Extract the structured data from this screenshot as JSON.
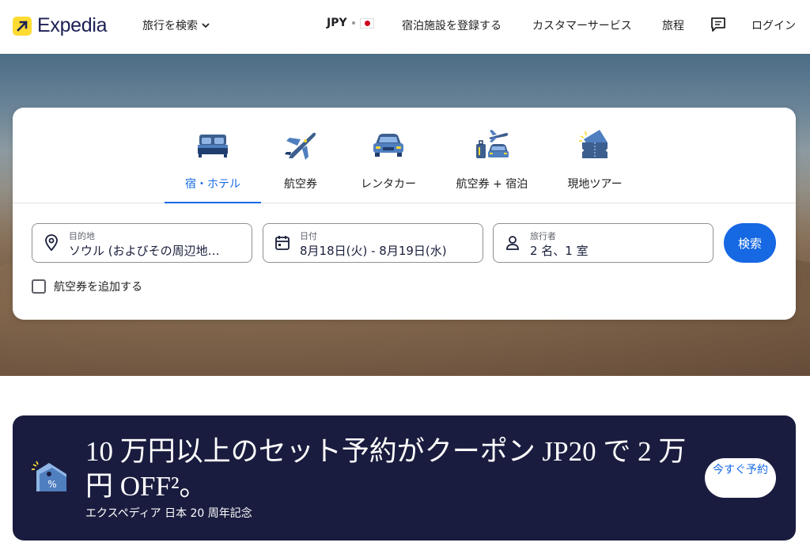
{
  "header": {
    "logo_text": "Expedia",
    "search_menu": "旅行を検索",
    "currency": "JPY",
    "list_property": "宿泊施設を登録する",
    "customer_service": "カスタマーサービス",
    "trips": "旅程",
    "login": "ログイン"
  },
  "search": {
    "tabs": [
      {
        "label": "宿・ホテル",
        "icon": "bed-icon",
        "active": true
      },
      {
        "label": "航空券",
        "icon": "airplane-icon",
        "active": false
      },
      {
        "label": "レンタカー",
        "icon": "car-icon",
        "active": false
      },
      {
        "label": "航空券 + 宿泊",
        "icon": "plane-luggage-car-icon",
        "active": false
      },
      {
        "label": "現地ツアー",
        "icon": "ticket-icon",
        "active": false
      }
    ],
    "destination": {
      "label": "目的地",
      "value": "ソウル (およびその周辺地…"
    },
    "dates": {
      "label": "日付",
      "value": "8月18日(火) - 8月19日(水)"
    },
    "travelers": {
      "label": "旅行者",
      "value": "2 名、1 室"
    },
    "search_button": "検索",
    "add_flight": "航空券を追加する"
  },
  "promo": {
    "title": "10 万円以上のセット予約がクーポン JP20 で 2 万円 OFF²。",
    "subtitle": "エクスペディア 日本 20 周年記念",
    "cta": "今すぐ予約"
  },
  "colors": {
    "accent": "#1668e3",
    "brand_yellow": "#fddb32",
    "promo_bg": "#1a1c3f"
  }
}
